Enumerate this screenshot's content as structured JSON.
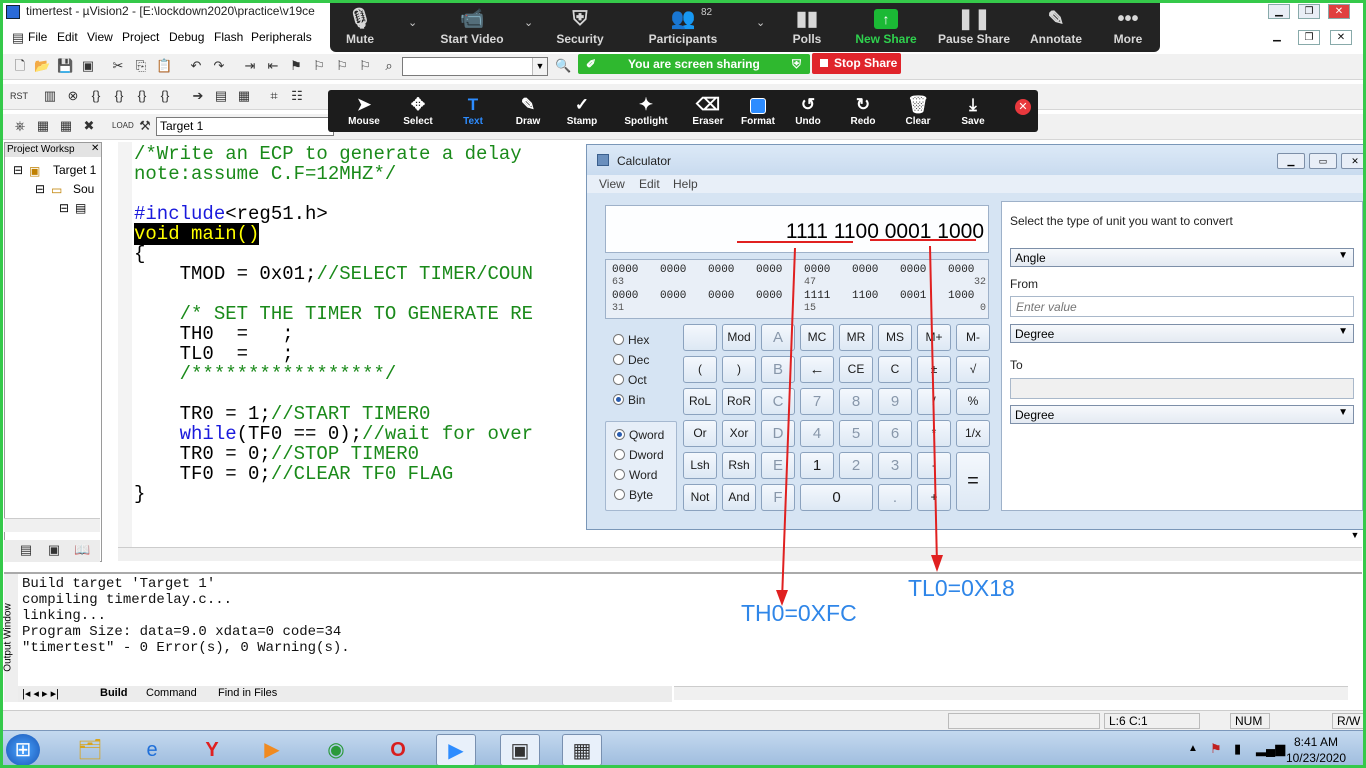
{
  "window": {
    "title": "timertest - µVision2 - [E:\\lockdown2020\\practice\\v19ce"
  },
  "menu": [
    "File",
    "Edit",
    "View",
    "Project",
    "Debug",
    "Flash",
    "Peripherals"
  ],
  "target_combo": "Target 1",
  "project_pane": {
    "header": "Project Worksp",
    "tree": [
      "Target 1",
      "Sou"
    ]
  },
  "code": {
    "lines": [
      "/*Write an ECP to generate a delay",
      "note:assume C.F=12MHZ*/",
      "",
      "#include<reg51.h>",
      "void main()",
      "{",
      "    TMOD = 0x01;//SELECT TIMER/COUN",
      "",
      "    /* SET THE TIMER TO GENERATE RE",
      "    TH0  =   ;",
      "    TL0  =   ;",
      "    /*****************/",
      "",
      "    TR0 = 1;//START TIMER0",
      "    while(TF0 == 0);//wait for over",
      "    TR0 = 0;//STOP TIMER0",
      "    TF0 = 0;//CLEAR TF0 FLAG",
      "}"
    ],
    "include_kw": "#include",
    "include_rest": "<reg51.h>",
    "void_main": "void main()",
    "while_kw": "while",
    "while_rest": "(TF0 == 0);",
    "while_comment": "//wait for over",
    "tmod": "    TMOD = 0x01;",
    "tmod_comment": "//SELECT TIMER/COUN",
    "tr0_1": "    TR0 = 1;",
    "tr0_1_comment": "//START TIMER0",
    "tr0_0": "    TR0 = 0;",
    "tr0_0_comment": "//STOP TIMER0",
    "tf0": "    TF0 = 0;",
    "tf0_comment": "//CLEAR TF0 FLAG"
  },
  "output": {
    "lines": [
      "Build target 'Target 1'",
      "compiling timerdelay.c...",
      "linking...",
      "Program Size: data=9.0 xdata=0 code=34",
      "\"timertest\" - 0 Error(s), 0 Warning(s)."
    ],
    "side_label": "Output Window",
    "tabs": [
      "Build",
      "Command",
      "Find in Files"
    ]
  },
  "status": {
    "position": "L:6 C:1",
    "num": "NUM",
    "rw": "R/W"
  },
  "taskbar": {
    "time": "8:41 AM",
    "date": "10/23/2020"
  },
  "zoom": {
    "items": [
      {
        "label": "Mute",
        "icon": "microphone-icon"
      },
      {
        "label": "Start Video",
        "icon": "video-off-icon"
      },
      {
        "label": "Security",
        "icon": "shield-icon"
      },
      {
        "label": "Participants",
        "icon": "participants-icon"
      },
      {
        "label": "Polls",
        "icon": "polls-icon"
      },
      {
        "label": "New Share",
        "icon": "share-icon"
      },
      {
        "label": "Pause Share",
        "icon": "pause-icon"
      },
      {
        "label": "Annotate",
        "icon": "pencil-icon"
      },
      {
        "label": "More",
        "icon": "more-icon"
      }
    ],
    "participant_count": "82",
    "sharing_text": "You are screen sharing",
    "stop_share": "Stop Share",
    "accent_green": "#1bb935",
    "accent_red": "#e0242b"
  },
  "annotate": {
    "tools": [
      "Mouse",
      "Select",
      "Text",
      "Draw",
      "Stamp",
      "Spotlight",
      "Eraser",
      "Format",
      "Undo",
      "Redo",
      "Clear",
      "Save"
    ],
    "active": "Text",
    "active_color": "#2d8cff"
  },
  "calculator": {
    "title": "Calculator",
    "menu": [
      "View",
      "Edit",
      "Help"
    ],
    "display": "1111 1100 0001 1000",
    "bits_row1": [
      "0000",
      "0000",
      "0000",
      "0000",
      "0000",
      "0000",
      "0000",
      "0000"
    ],
    "bits_row1_nums": [
      "63",
      "47",
      "32"
    ],
    "bits_row2": [
      "0000",
      "0000",
      "0000",
      "0000",
      "1111",
      "1100",
      "0001",
      "1000"
    ],
    "bits_row2_nums": [
      "31",
      "15",
      "0"
    ],
    "bases": [
      "Hex",
      "Dec",
      "Oct",
      "Bin"
    ],
    "base_selected": "Bin",
    "sizes": [
      "Qword",
      "Dword",
      "Word",
      "Byte"
    ],
    "size_selected": "Qword",
    "keys": [
      [
        "",
        "Mod",
        "A",
        "MC",
        "MR",
        "MS",
        "M+",
        "M-"
      ],
      [
        "(",
        ")",
        "B",
        "←",
        "CE",
        "C",
        "±",
        "√"
      ],
      [
        "RoL",
        "RoR",
        "C",
        "7",
        "8",
        "9",
        "/",
        "%"
      ],
      [
        "Or",
        "Xor",
        "D",
        "4",
        "5",
        "6",
        "*",
        "1/x"
      ],
      [
        "Lsh",
        "Rsh",
        "E",
        "1",
        "2",
        "3",
        "-",
        "="
      ],
      [
        "Not",
        "And",
        "F",
        "0",
        ".",
        "+"
      ]
    ],
    "converter": {
      "prompt": "Select the type of unit you want to convert",
      "type": "Angle",
      "from_label": "From",
      "from_placeholder": "Enter value",
      "from_unit": "Degree",
      "to_label": "To",
      "to_unit": "Degree"
    }
  },
  "annotations": {
    "th0": "TH0=0XFC",
    "tl0": "TL0=0X18",
    "arrow_color": "#e02020",
    "label_color": "#2f86e8"
  }
}
